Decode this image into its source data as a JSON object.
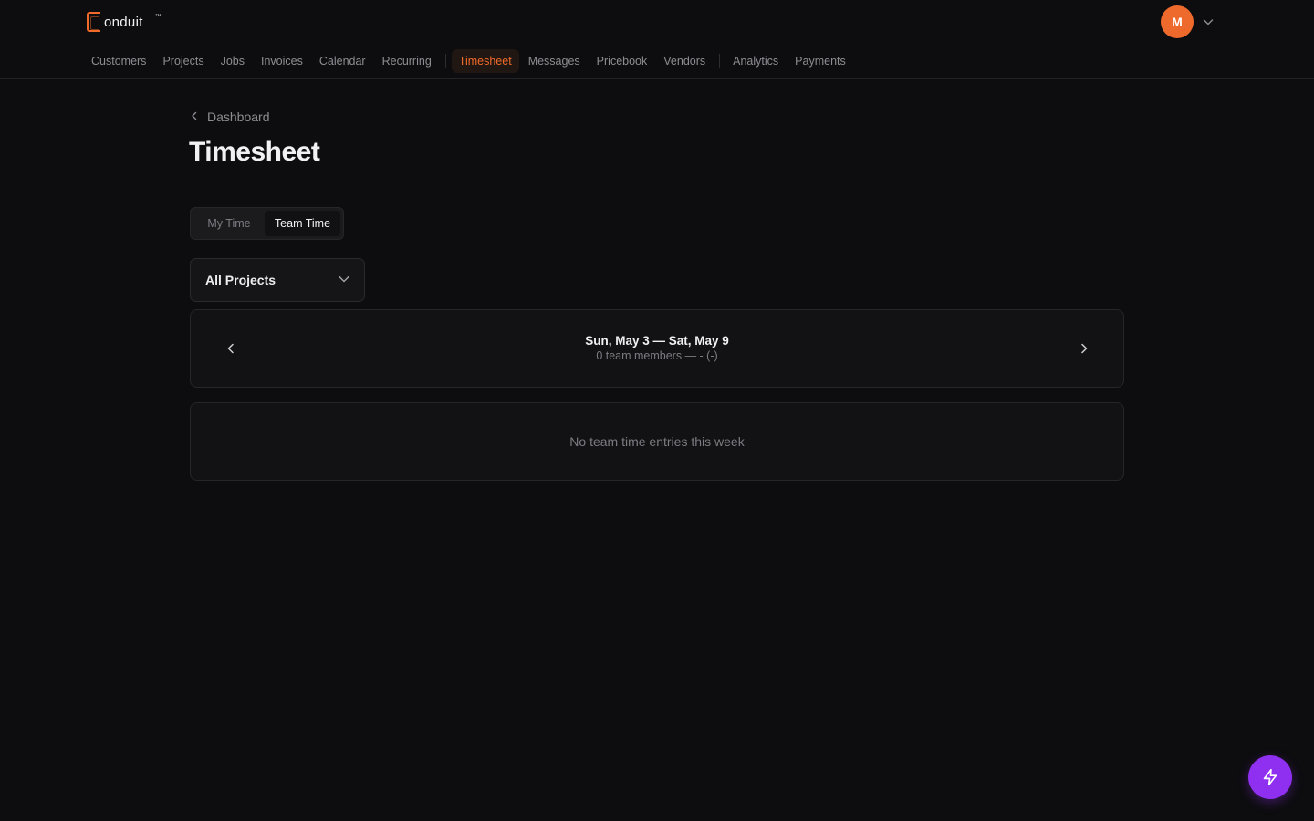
{
  "app": {
    "logo_text": "onduit",
    "logo_tm": "™",
    "avatar_initial": "M"
  },
  "nav": {
    "items": [
      {
        "label": "Customers"
      },
      {
        "label": "Projects"
      },
      {
        "label": "Jobs"
      },
      {
        "label": "Invoices"
      },
      {
        "label": "Calendar"
      },
      {
        "label": "Recurring"
      },
      {
        "label": "Timesheet",
        "active": true
      },
      {
        "label": "Messages"
      },
      {
        "label": "Pricebook"
      },
      {
        "label": "Vendors"
      },
      {
        "label": "Analytics"
      },
      {
        "label": "Payments"
      }
    ]
  },
  "breadcrumb": {
    "label": "Dashboard"
  },
  "page": {
    "title": "Timesheet"
  },
  "toggle": {
    "my_time": "My Time",
    "team_time": "Team Time",
    "selected": "Team Time"
  },
  "project_filter": {
    "value": "All Projects"
  },
  "week": {
    "range": "Sun, May 3 — Sat, May 9",
    "subtitle": "0 team members — - (-)"
  },
  "empty_state": {
    "message": "No team time entries this week"
  },
  "icons": {
    "avatar_menu": "chevron-down-icon",
    "breadcrumb_back": "chevron-left-icon",
    "select_chevron": "chevron-down-icon",
    "prev_week": "chevron-left-icon",
    "next_week": "chevron-right-icon",
    "fab": "lightning-icon"
  },
  "colors": {
    "accent": "#f06a2a",
    "fab": "#8f2ff0",
    "background": "#0d0d0f"
  }
}
